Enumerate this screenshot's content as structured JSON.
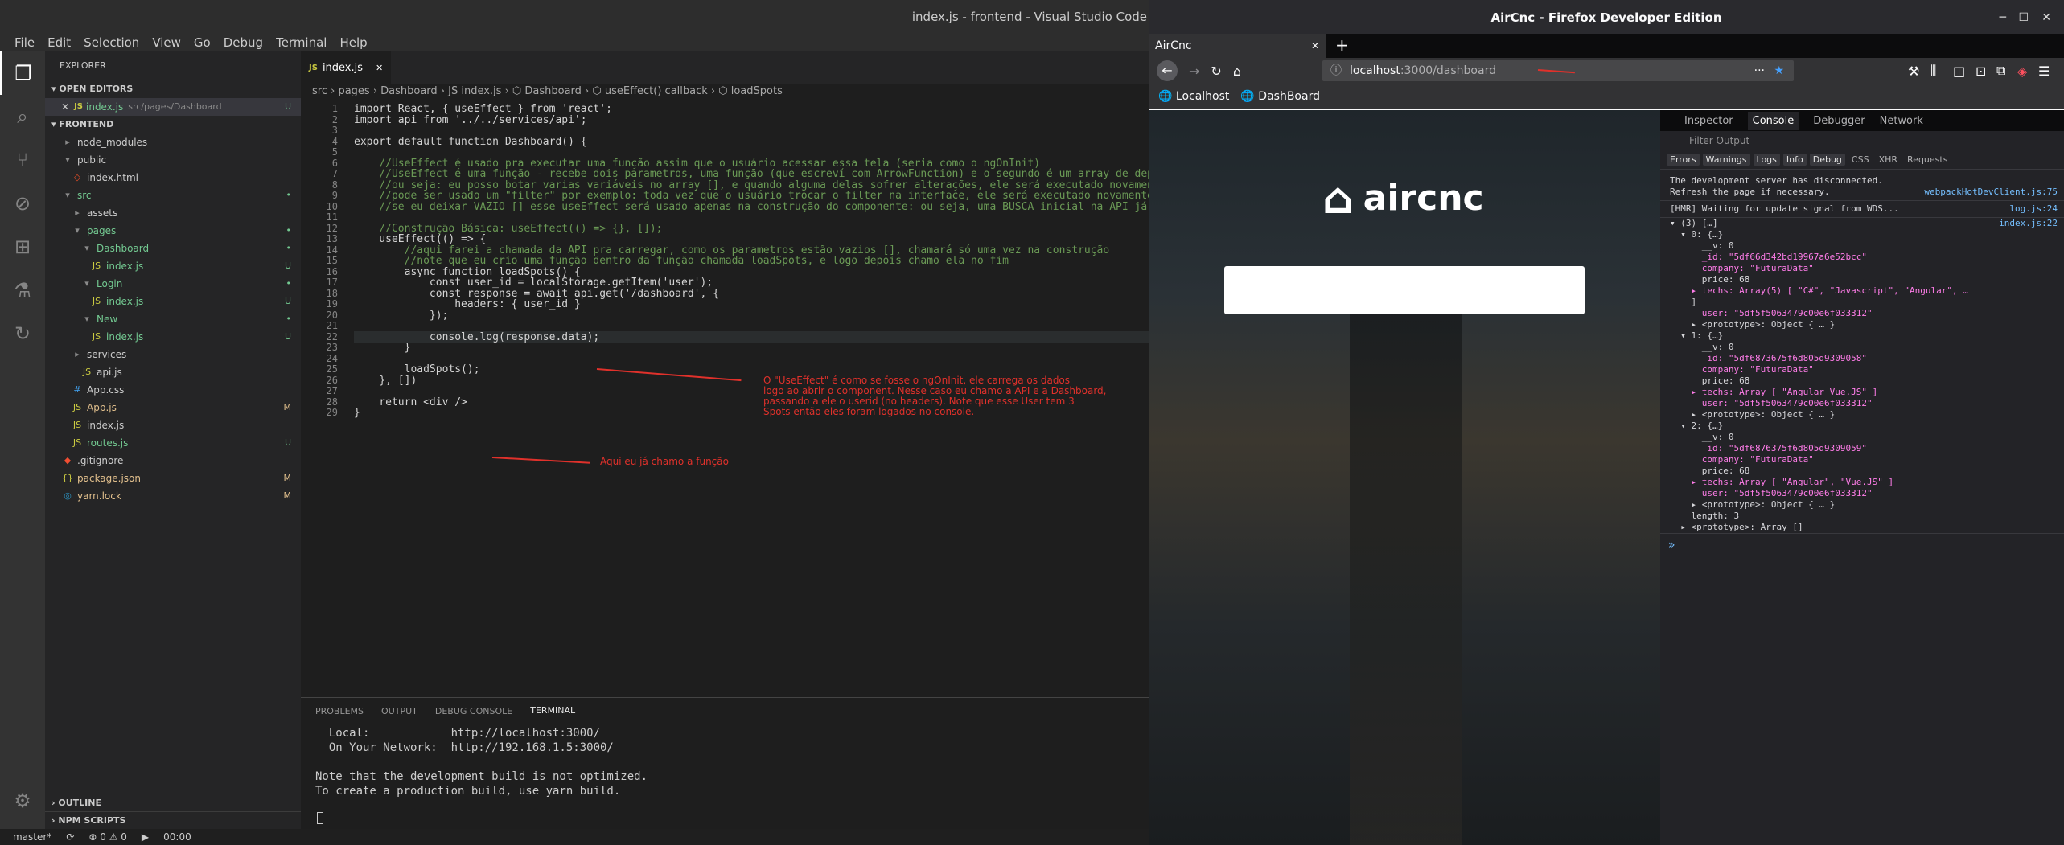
{
  "vscode": {
    "title": "index.js - frontend - Visual Studio Code",
    "menu": [
      "File",
      "Edit",
      "Selection",
      "View",
      "Go",
      "Debug",
      "Terminal",
      "Help"
    ],
    "explorer_title": "EXPLORER",
    "open_editors": "OPEN EDITORS",
    "open_file": "index.js",
    "open_file_path": "src/pages/Dashboard",
    "project": "FRONTEND",
    "tree": [
      {
        "label": "node_modules",
        "depth": 1,
        "icon": "folder",
        "status": ""
      },
      {
        "label": "public",
        "depth": 1,
        "icon": "folder-open",
        "status": ""
      },
      {
        "label": "index.html",
        "depth": 2,
        "icon": "html",
        "status": ""
      },
      {
        "label": "src",
        "depth": 1,
        "icon": "folder-open",
        "status": "•"
      },
      {
        "label": "assets",
        "depth": 2,
        "icon": "folder",
        "status": ""
      },
      {
        "label": "pages",
        "depth": 2,
        "icon": "folder-open",
        "status": "•"
      },
      {
        "label": "Dashboard",
        "depth": 3,
        "icon": "folder-open",
        "status": "•"
      },
      {
        "label": "index.js",
        "depth": 4,
        "icon": "js",
        "status": "U"
      },
      {
        "label": "Login",
        "depth": 3,
        "icon": "folder-open",
        "status": "•"
      },
      {
        "label": "index.js",
        "depth": 4,
        "icon": "js",
        "status": "U"
      },
      {
        "label": "New",
        "depth": 3,
        "icon": "folder-open",
        "status": "•"
      },
      {
        "label": "index.js",
        "depth": 4,
        "icon": "js",
        "status": "U"
      },
      {
        "label": "services",
        "depth": 2,
        "icon": "folder",
        "status": ""
      },
      {
        "label": "api.js",
        "depth": 3,
        "icon": "js",
        "status": ""
      },
      {
        "label": "App.css",
        "depth": 2,
        "icon": "css",
        "status": ""
      },
      {
        "label": "App.js",
        "depth": 2,
        "icon": "js",
        "status": "M"
      },
      {
        "label": "index.js",
        "depth": 2,
        "icon": "js",
        "status": ""
      },
      {
        "label": "routes.js",
        "depth": 2,
        "icon": "js",
        "status": "U"
      },
      {
        "label": ".gitignore",
        "depth": 1,
        "icon": "git",
        "status": ""
      },
      {
        "label": "package.json",
        "depth": 1,
        "icon": "json",
        "status": "M"
      },
      {
        "label": "yarn.lock",
        "depth": 1,
        "icon": "yarn",
        "status": "M"
      }
    ],
    "outline": "OUTLINE",
    "npm_scripts": "NPM SCRIPTS",
    "tab_label": "index.js",
    "breadcrumb": "src › pages › Dashboard › JS index.js › ⬡ Dashboard › ⬡ useEffect() callback › ⬡ loadSpots",
    "code_lines": [
      "import React, { useEffect } from 'react';",
      "import api from '../../services/api';",
      "",
      "export default function Dashboard() {",
      "",
      "    //UseEffect é usado pra executar uma função assim que o usuário acessar essa tela (seria como o ngOnInit)",
      "    //UseEffect é uma função - recebe dois parametros, uma função (que escreví com ArrowFunction) e o segundo é um array de depen",
      "    //ou seja: eu posso botar varias variáveis no array [], e quando alguma delas sofrer alterações, ele será executado novamente",
      "    //pode ser usado um \"filter\" por exemplo: toda vez que o usuário trocar o filter na interface, ele será executado novamente.",
      "    //se eu deixar VAZIO [] esse useEffect será usado apenas na construção do componente: ou seja, uma BUSCA inicial na API já res",
      "",
      "    //Construção Básica: useEffect(() => {}, []);",
      "    useEffect(() => {",
      "        //aqui farei a chamada da API pra carregar, como os parametros estão vazios [], chamará só uma vez na construção",
      "        //note que eu crio uma função dentro da função chamada loadSpots, e logo depois chamo ela no fim",
      "        async function loadSpots() {",
      "            const user_id = localStorage.getItem('user');",
      "            const response = await api.get('/dashboard', {",
      "                headers: { user_id }",
      "            });",
      "",
      "            console.log(response.data);",
      "        }",
      "",
      "        loadSpots();",
      "    }, [])",
      "",
      "    return <div />",
      "}"
    ],
    "annotation_1": "O \"UseEffect\" é como se fosse o ngOnInit, ele carrega os dados\nlogo ao abrir o component. Nesse caso eu chamo a API e a Dashboard,\npassando a ele o userid (no headers). Note que esse User tem 3\nSpots então eles foram logados no console.",
    "annotation_2": "Aqui eu já chamo a função",
    "panel_tabs": [
      "PROBLEMS",
      "OUTPUT",
      "DEBUG CONSOLE",
      "TERMINAL"
    ],
    "terminal_lines": [
      "  Local:            http://localhost:3000/",
      "  On Your Network:  http://192.168.1.5:3000/",
      "",
      "Note that the development build is not optimized.",
      "To create a production build, use yarn build.",
      "",
      ""
    ],
    "status_branch": "master*",
    "status_problems": "⊗ 0 ⚠ 0",
    "status_time": "00:00"
  },
  "firefox": {
    "title": "AirCnc - Firefox Developer Edition",
    "tab_title": "AirCnc",
    "url_host": "localhost",
    "url_path": ":3000/dashboard",
    "bookmarks": [
      "Localhost",
      "DashBoard"
    ],
    "logo_text": "aircnc",
    "devtools_tabs": [
      "Inspector",
      "Console",
      "Debugger",
      "Network"
    ],
    "filter_placeholder": "Filter Output",
    "levels": [
      "Errors",
      "Warnings",
      "Logs",
      "Info",
      "Debug",
      "CSS",
      "XHR",
      "Requests"
    ],
    "console": [
      {
        "text": "The development server has disconnected.\nRefresh the page if necessary.",
        "src": "webpackHotDevClient.js:75"
      },
      {
        "text": "[HMR] Waiting for update signal from WDS...",
        "src": "log.js:24"
      },
      {
        "text": "▾ (3) […]",
        "src": "index.js:22"
      },
      {
        "text": "  ▾ 0: {…}",
        "src": ""
      },
      {
        "text": "      __v: 0",
        "src": ""
      },
      {
        "text": "      _id: \"5df66d342bd19967a6e52bcc\"",
        "src": ""
      },
      {
        "text": "      company: \"FuturaData\"",
        "src": ""
      },
      {
        "text": "      price: 68",
        "src": ""
      },
      {
        "text": "    ▸ techs: Array(5) [ \"C#\", \"Javascript\", \"Angular\", …",
        "src": ""
      },
      {
        "text": "    ]",
        "src": ""
      },
      {
        "text": "      user: \"5df5f5063479c00e6f033312\"",
        "src": ""
      },
      {
        "text": "    ▸ <prototype>: Object { … }",
        "src": ""
      },
      {
        "text": "  ▾ 1: {…}",
        "src": ""
      },
      {
        "text": "      __v: 0",
        "src": ""
      },
      {
        "text": "      _id: \"5df6873675f6d805d9309058\"",
        "src": ""
      },
      {
        "text": "      company: \"FuturaData\"",
        "src": ""
      },
      {
        "text": "      price: 68",
        "src": ""
      },
      {
        "text": "    ▸ techs: Array [ \"Angular Vue.JS\" ]",
        "src": ""
      },
      {
        "text": "      user: \"5df5f5063479c00e6f033312\"",
        "src": ""
      },
      {
        "text": "    ▸ <prototype>: Object { … }",
        "src": ""
      },
      {
        "text": "  ▾ 2: {…}",
        "src": ""
      },
      {
        "text": "      __v: 0",
        "src": ""
      },
      {
        "text": "      _id: \"5df6876375f6d805d9309059\"",
        "src": ""
      },
      {
        "text": "      company: \"FuturaData\"",
        "src": ""
      },
      {
        "text": "      price: 68",
        "src": ""
      },
      {
        "text": "    ▸ techs: Array [ \"Angular\", \"Vue.JS\" ]",
        "src": ""
      },
      {
        "text": "      user: \"5df5f5063479c00e6f033312\"",
        "src": ""
      },
      {
        "text": "    ▸ <prototype>: Object { … }",
        "src": ""
      },
      {
        "text": "    length: 3",
        "src": ""
      },
      {
        "text": "  ▸ <prototype>: Array []",
        "src": ""
      }
    ],
    "prompt": "»"
  },
  "colors": {
    "accent": "#e0312b",
    "vscode_bg": "#1e1e1e",
    "sidebar": "#252526"
  }
}
